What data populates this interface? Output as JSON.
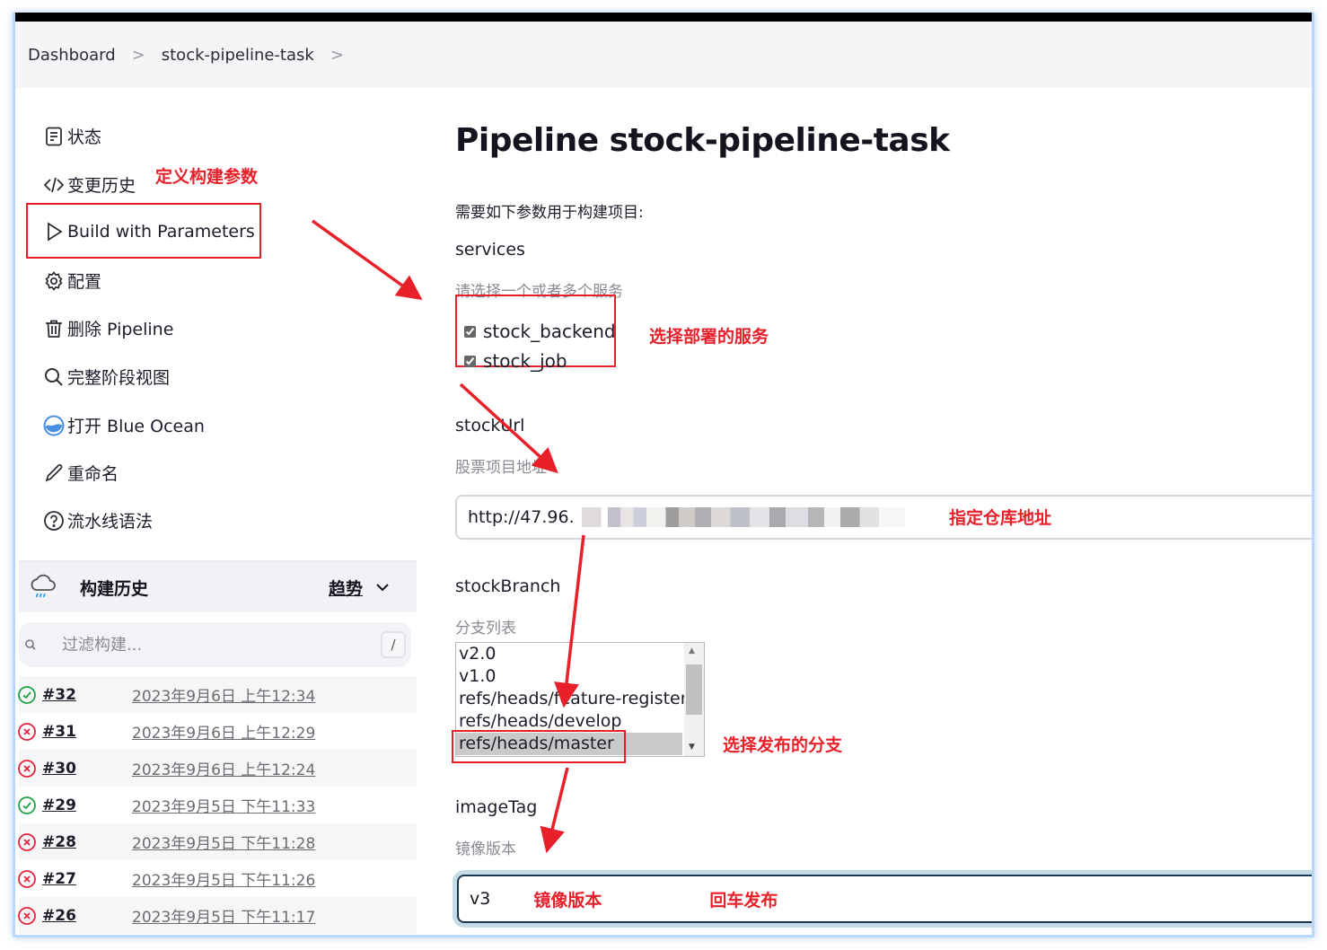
{
  "breadcrumb": {
    "items": [
      "Dashboard",
      "stock-pipeline-task"
    ],
    "separator": ">"
  },
  "sidebar": {
    "tasks": [
      {
        "icon": "document-icon",
        "label": "状态"
      },
      {
        "icon": "code-icon",
        "label": "变更历史"
      },
      {
        "icon": "play-icon",
        "label": "Build with Parameters"
      },
      {
        "icon": "gear-icon",
        "label": "配置"
      },
      {
        "icon": "trash-icon",
        "label": "删除 Pipeline"
      },
      {
        "icon": "search-icon",
        "label": "完整阶段视图"
      },
      {
        "icon": "blue-ocean-icon",
        "label": "打开 Blue Ocean"
      },
      {
        "icon": "pencil-icon",
        "label": "重命名"
      },
      {
        "icon": "help-icon",
        "label": "流水线语法"
      }
    ]
  },
  "build_history": {
    "title": "构建历史",
    "trend_label": "趋势",
    "filter_placeholder": "过滤构建...",
    "filter_shortcut": "/",
    "builds": [
      {
        "number": "#32",
        "date": "2023年9月6日 上午12:34",
        "status": "success"
      },
      {
        "number": "#31",
        "date": "2023年9月6日 上午12:29",
        "status": "failed"
      },
      {
        "number": "#30",
        "date": "2023年9月6日 上午12:24",
        "status": "failed"
      },
      {
        "number": "#29",
        "date": "2023年9月5日 下午11:33",
        "status": "success"
      },
      {
        "number": "#28",
        "date": "2023年9月5日 下午11:28",
        "status": "failed"
      },
      {
        "number": "#27",
        "date": "2023年9月5日 下午11:26",
        "status": "failed"
      },
      {
        "number": "#26",
        "date": "2023年9月5日 下午11:17",
        "status": "failed"
      }
    ]
  },
  "main": {
    "title": "Pipeline stock-pipeline-task",
    "description": "需要如下参数用于构建项目:",
    "params": {
      "services": {
        "name": "services",
        "help": "请选择一个或者多个服务",
        "options": [
          {
            "label": "stock_backend",
            "checked": true
          },
          {
            "label": "stock_job",
            "checked": true
          }
        ]
      },
      "stockUrl": {
        "name": "stockUrl",
        "help": "股票项目地址",
        "value_visible": "http://47.96."
      },
      "stockBranch": {
        "name": "stockBranch",
        "help": "分支列表",
        "options": [
          "v2.0",
          "v1.0",
          "refs/heads/feature-register",
          "refs/heads/develop",
          "refs/heads/master"
        ],
        "selected": "refs/heads/master"
      },
      "imageTag": {
        "name": "imageTag",
        "help": "镜像版本",
        "value": "v3"
      }
    }
  },
  "annotations": {
    "define_params": "定义构建参数",
    "select_services": "选择部署的服务",
    "repo_url": "指定仓库地址",
    "select_branch": "选择发布的分支",
    "image_version": "镜像版本",
    "press_enter": "回车发布"
  },
  "colors": {
    "annotation_red": "#e8202a",
    "success_green": "#1ea446",
    "failed_red": "#e6223c",
    "focus_border": "#19374f"
  }
}
